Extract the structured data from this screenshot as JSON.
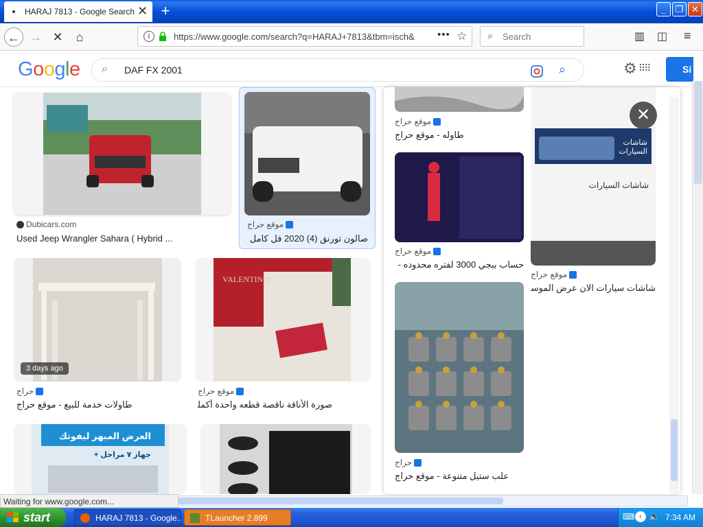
{
  "browser": {
    "tab_title": "HARAJ 7813 - Google Search",
    "tab_close": "✕",
    "new_tab": "+",
    "url": "https://www.google.com/search?q=HARAJ+7813&tbm=isch&",
    "search_placeholder": "Search",
    "status": "Waiting for www.google.com..."
  },
  "google": {
    "logo": [
      "G",
      "o",
      "o",
      "g",
      "l",
      "e"
    ],
    "logo_colors": [
      "#4285f4",
      "#ea4335",
      "#fbbc05",
      "#4285f4",
      "#34a853",
      "#ea4335"
    ],
    "query": "DAF FX 2001",
    "signin_label": "Si"
  },
  "results": [
    {
      "source": "Dubicars.com",
      "caption": "Used Jeep Wrangler Sahara ( Hybrid ..."
    },
    {
      "source": "موقع حراج",
      "caption": "صالون تورنق (4) 2020 فل كامل ..."
    },
    {
      "source": "حراج",
      "caption": "طاولات خدمة للبيع - موقع حراج",
      "badge": "3 days ago"
    },
    {
      "source": "موقع حراج",
      "caption": "صورة الأناقة ناقصة قطعه واحدة أكملها ..."
    }
  ],
  "panel": {
    "items": [
      {
        "source": "موقع حراج",
        "caption": "طاوله - موقع حراج"
      },
      {
        "source": "موقع حراج",
        "caption": "حساب ببجي 3000 لفتره محدوده - ..."
      },
      {
        "source": "حراج",
        "caption": "علب ستيل متنوعة - موقع حراج"
      },
      {
        "source": "موقع حراج",
        "caption": "شاشات سيارات الان عرض الموسم ا..."
      }
    ],
    "screen_text_1": "شاشات السيارات",
    "screen_text_2": "شاشات السيارات",
    "promo_text": "العرض المبهر ليفوتك",
    "promo_sub": "جهاز ٧ مراحل +"
  },
  "taskbar": {
    "start_label": "start",
    "task_firefox": "HARAJ 7813 - Google...",
    "task_tlauncher": "TLauncher 2.899",
    "clock": "7:34 AM"
  },
  "valentino": "VALENTINO"
}
